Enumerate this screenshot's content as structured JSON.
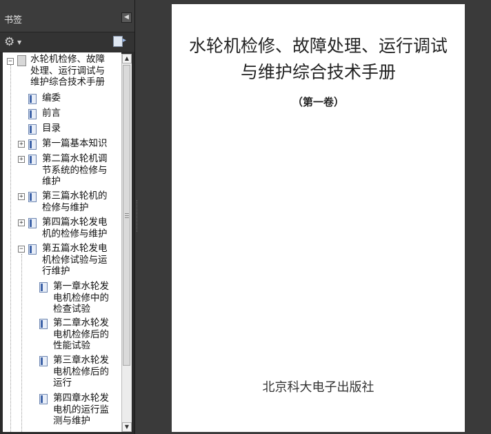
{
  "bookmarks_panel": {
    "title": "书签",
    "items": [
      {
        "label": "水轮机检修、故障处理、运行调试与维护综合技术手册",
        "lines": [
          "水轮机检修、故障",
          "处理、运行调试与",
          "维护综合技术手册"
        ]
      },
      {
        "label": "编委"
      },
      {
        "label": "前言"
      },
      {
        "label": "目录"
      },
      {
        "label": "第一篇基本知识"
      },
      {
        "lines": [
          "第二篇水轮机调",
          "节系统的检修与",
          "维护"
        ]
      },
      {
        "lines": [
          "第三篇水轮机的",
          "检修与维护"
        ]
      },
      {
        "lines": [
          "第四篇水轮发电",
          "机的检修与维护"
        ]
      },
      {
        "lines": [
          "第五篇水轮发电",
          "机检修试验与运",
          "行维护"
        ]
      },
      {
        "lines": [
          "第一章水轮发",
          "电机检修中的",
          "检查试验"
        ]
      },
      {
        "lines": [
          "第二章水轮发",
          "电机检修后的",
          "性能试验"
        ]
      },
      {
        "lines": [
          "第三章水轮发",
          "电机检修后的",
          "运行"
        ]
      },
      {
        "lines": [
          "第四章水轮发",
          "电机的运行监",
          "测与维护"
        ]
      }
    ]
  },
  "document": {
    "title_line1": "水轮机检修、故障处理、运行调试",
    "title_line2": "与维护综合技术手册",
    "volume": "（第一卷）",
    "publisher": "北京科大电子出版社"
  }
}
